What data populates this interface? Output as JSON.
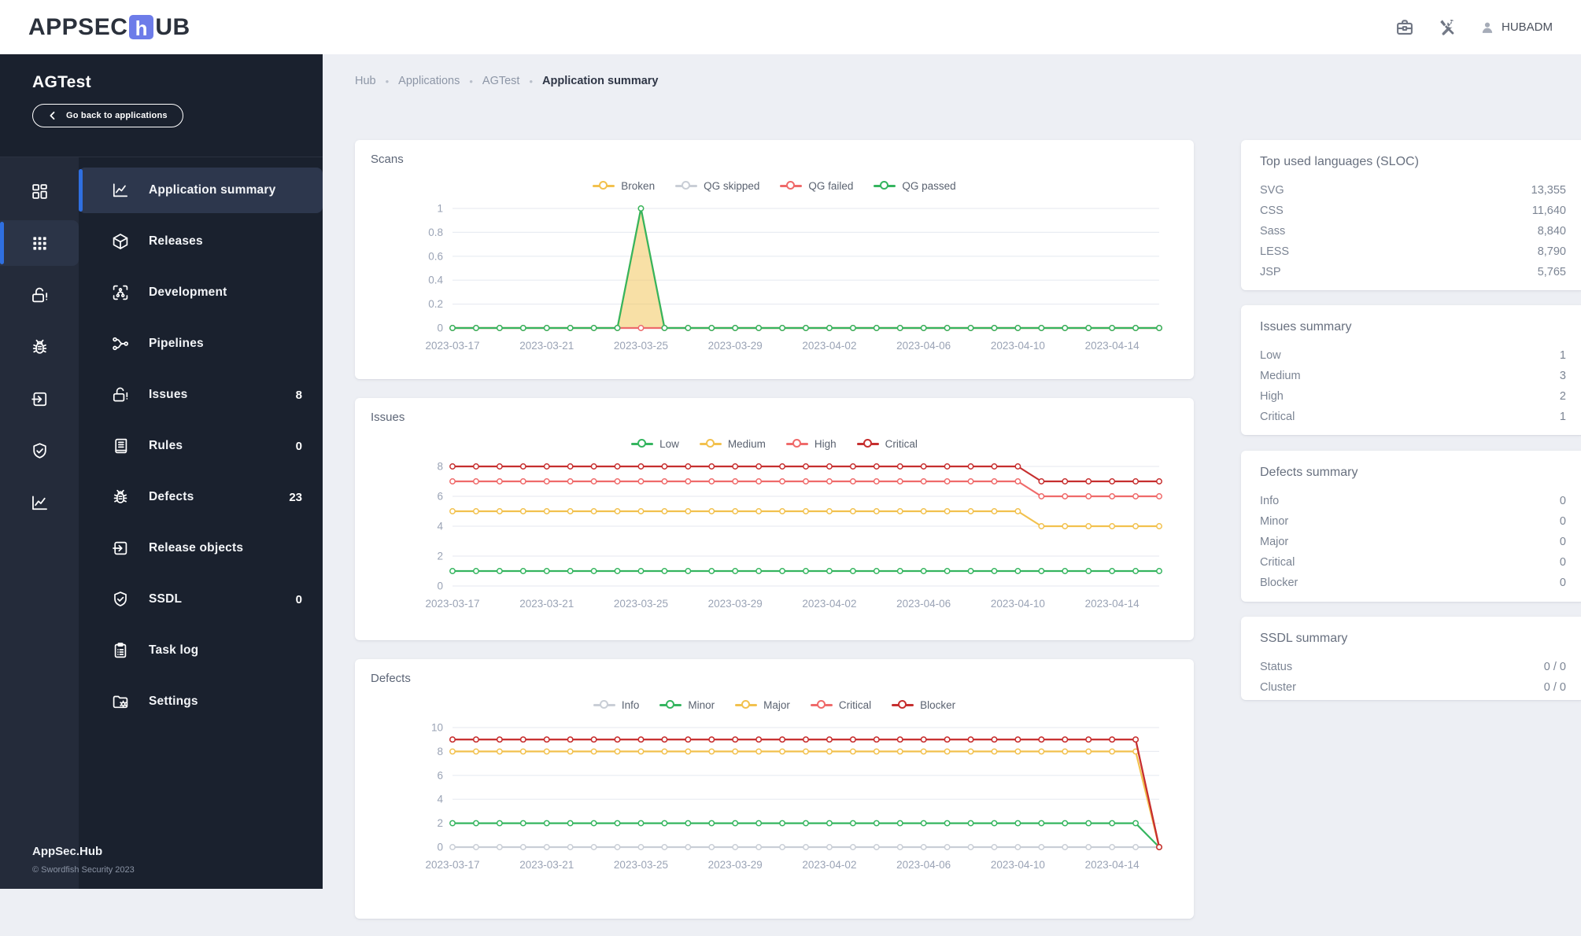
{
  "colors": {
    "accent_blue": "#2f6fe0",
    "logo_blue": "#6d7ce9",
    "sidebar_bg": "#1a212e"
  },
  "header": {
    "logo_prefix": "APPSEC",
    "logo_box_letter": "h",
    "logo_suffix": "UB",
    "icons": [
      "briefcase-icon",
      "tools-icon",
      "user-icon"
    ],
    "user": "HUBADM"
  },
  "sidebar": {
    "app_name": "AGTest",
    "back_button": "Go back to applications",
    "rail": [
      {
        "icon": "dashboard-icon",
        "active": false
      },
      {
        "icon": "grid-icon",
        "active": true
      },
      {
        "icon": "unlock-alert-icon",
        "active": false
      },
      {
        "icon": "bug-icon",
        "active": false
      },
      {
        "icon": "box-arrow-icon",
        "active": false
      },
      {
        "icon": "shield-check-icon",
        "active": false
      },
      {
        "icon": "chart-line-icon",
        "active": false
      }
    ],
    "items": [
      {
        "label": "Application summary",
        "icon": "chart-line-icon",
        "active": true
      },
      {
        "label": "Releases",
        "icon": "package-icon"
      },
      {
        "label": "Development",
        "icon": "development-icon"
      },
      {
        "label": "Pipelines",
        "icon": "pipeline-icon"
      },
      {
        "label": "Issues",
        "icon": "unlock-alert-icon",
        "count": "8"
      },
      {
        "label": "Rules",
        "icon": "rules-icon",
        "count": "0"
      },
      {
        "label": "Defects",
        "icon": "bug-icon",
        "count": "23"
      },
      {
        "label": "Release objects",
        "icon": "box-arrow-icon"
      },
      {
        "label": "SSDL",
        "icon": "shield-check-icon",
        "count": "0"
      },
      {
        "label": "Task log",
        "icon": "clipboard-icon"
      },
      {
        "label": "Settings",
        "icon": "folder-gear-icon"
      }
    ],
    "footer_title": "AppSec.Hub",
    "footer_copyright": "© Swordfish Security 2023"
  },
  "breadcrumb": [
    "Hub",
    "Applications",
    "AGTest",
    "Application summary"
  ],
  "chart_data": [
    {
      "name": "scans",
      "type": "line",
      "title": "Scans",
      "n_points": 31,
      "x_start": "2023-03-17",
      "x_end": "2023-04-16",
      "x_labels": [
        "2023-03-17",
        "2023-03-21",
        "2023-03-25",
        "2023-03-29",
        "2023-04-02",
        "2023-04-06",
        "2023-04-10",
        "2023-04-14"
      ],
      "x_label_indices": [
        0,
        4,
        8,
        12,
        16,
        20,
        24,
        28
      ],
      "y_max": 1,
      "y_ticks": [
        "0",
        "0.2",
        "0.4",
        "0.6",
        "0.8",
        "1"
      ],
      "grid": true,
      "legend_position": "top",
      "series": [
        {
          "name": "Broken",
          "color": "#f2c14e",
          "fill": "rgba(242,193,78,0.5)",
          "values": [
            0,
            0,
            0,
            0,
            0,
            0,
            0,
            0,
            1,
            0,
            0,
            0,
            0,
            0,
            0,
            0,
            0,
            0,
            0,
            0,
            0,
            0,
            0,
            0,
            0,
            0,
            0,
            0,
            0,
            0,
            0
          ]
        },
        {
          "name": "QG skipped",
          "color": "#c9ced6",
          "values": [
            0,
            0,
            0,
            0,
            0,
            0,
            0,
            0,
            0,
            0,
            0,
            0,
            0,
            0,
            0,
            0,
            0,
            0,
            0,
            0,
            0,
            0,
            0,
            0,
            0,
            0,
            0,
            0,
            0,
            0,
            0
          ]
        },
        {
          "name": "QG failed",
          "color": "#ef6a6a",
          "values": [
            0,
            0,
            0,
            0,
            0,
            0,
            0,
            0,
            0,
            0,
            0,
            0,
            0,
            0,
            0,
            0,
            0,
            0,
            0,
            0,
            0,
            0,
            0,
            0,
            0,
            0,
            0,
            0,
            0,
            0,
            0
          ]
        },
        {
          "name": "QG passed",
          "color": "#35b55f",
          "values": [
            0,
            0,
            0,
            0,
            0,
            0,
            0,
            0,
            1,
            0,
            0,
            0,
            0,
            0,
            0,
            0,
            0,
            0,
            0,
            0,
            0,
            0,
            0,
            0,
            0,
            0,
            0,
            0,
            0,
            0,
            0
          ]
        }
      ]
    },
    {
      "name": "issues",
      "type": "line",
      "title": "Issues",
      "n_points": 31,
      "x_start": "2023-03-17",
      "x_end": "2023-04-16",
      "x_labels": [
        "2023-03-17",
        "2023-03-21",
        "2023-03-25",
        "2023-03-29",
        "2023-04-02",
        "2023-04-06",
        "2023-04-10",
        "2023-04-14"
      ],
      "x_label_indices": [
        0,
        4,
        8,
        12,
        16,
        20,
        24,
        28
      ],
      "y_max": 8,
      "y_ticks": [
        "0",
        "2",
        "4",
        "6",
        "8"
      ],
      "grid": true,
      "legend_position": "top",
      "series": [
        {
          "name": "Low",
          "color": "#35b55f",
          "values": [
            1,
            1,
            1,
            1,
            1,
            1,
            1,
            1,
            1,
            1,
            1,
            1,
            1,
            1,
            1,
            1,
            1,
            1,
            1,
            1,
            1,
            1,
            1,
            1,
            1,
            1,
            1,
            1,
            1,
            1,
            1
          ]
        },
        {
          "name": "Medium",
          "color": "#f2c14e",
          "values": [
            5,
            5,
            5,
            5,
            5,
            5,
            5,
            5,
            5,
            5,
            5,
            5,
            5,
            5,
            5,
            5,
            5,
            5,
            5,
            5,
            5,
            5,
            5,
            5,
            5,
            4,
            4,
            4,
            4,
            4,
            4
          ]
        },
        {
          "name": "High",
          "color": "#ef6a6a",
          "values": [
            7,
            7,
            7,
            7,
            7,
            7,
            7,
            7,
            7,
            7,
            7,
            7,
            7,
            7,
            7,
            7,
            7,
            7,
            7,
            7,
            7,
            7,
            7,
            7,
            7,
            6,
            6,
            6,
            6,
            6,
            6
          ]
        },
        {
          "name": "Critical",
          "color": "#c62f2f",
          "values": [
            8,
            8,
            8,
            8,
            8,
            8,
            8,
            8,
            8,
            8,
            8,
            8,
            8,
            8,
            8,
            8,
            8,
            8,
            8,
            8,
            8,
            8,
            8,
            8,
            8,
            7,
            7,
            7,
            7,
            7,
            7
          ]
        }
      ]
    },
    {
      "name": "defects",
      "type": "line",
      "title": "Defects",
      "n_points": 31,
      "x_start": "2023-03-17",
      "x_end": "2023-04-16",
      "x_labels": [
        "2023-03-17",
        "2023-03-21",
        "2023-03-25",
        "2023-03-29",
        "2023-04-02",
        "2023-04-06",
        "2023-04-10",
        "2023-04-14"
      ],
      "x_label_indices": [
        0,
        4,
        8,
        12,
        16,
        20,
        24,
        28
      ],
      "y_max": 10,
      "y_ticks": [
        "0",
        "2",
        "4",
        "6",
        "8",
        "10"
      ],
      "grid": true,
      "legend_position": "top",
      "series": [
        {
          "name": "Info",
          "color": "#c9ced6",
          "values": [
            0,
            0,
            0,
            0,
            0,
            0,
            0,
            0,
            0,
            0,
            0,
            0,
            0,
            0,
            0,
            0,
            0,
            0,
            0,
            0,
            0,
            0,
            0,
            0,
            0,
            0,
            0,
            0,
            0,
            0,
            0
          ]
        },
        {
          "name": "Minor",
          "color": "#35b55f",
          "values": [
            2,
            2,
            2,
            2,
            2,
            2,
            2,
            2,
            2,
            2,
            2,
            2,
            2,
            2,
            2,
            2,
            2,
            2,
            2,
            2,
            2,
            2,
            2,
            2,
            2,
            2,
            2,
            2,
            2,
            2,
            0
          ]
        },
        {
          "name": "Major",
          "color": "#f2c14e",
          "values": [
            8,
            8,
            8,
            8,
            8,
            8,
            8,
            8,
            8,
            8,
            8,
            8,
            8,
            8,
            8,
            8,
            8,
            8,
            8,
            8,
            8,
            8,
            8,
            8,
            8,
            8,
            8,
            8,
            8,
            8,
            0
          ]
        },
        {
          "name": "Critical",
          "color": "#ef6a6a",
          "values": [
            9,
            9,
            9,
            9,
            9,
            9,
            9,
            9,
            9,
            9,
            9,
            9,
            9,
            9,
            9,
            9,
            9,
            9,
            9,
            9,
            9,
            9,
            9,
            9,
            9,
            9,
            9,
            9,
            9,
            9,
            0
          ]
        },
        {
          "name": "Blocker",
          "color": "#c62f2f",
          "values": [
            9,
            9,
            9,
            9,
            9,
            9,
            9,
            9,
            9,
            9,
            9,
            9,
            9,
            9,
            9,
            9,
            9,
            9,
            9,
            9,
            9,
            9,
            9,
            9,
            9,
            9,
            9,
            9,
            9,
            9,
            0
          ]
        }
      ]
    }
  ],
  "panels": [
    {
      "title": "Top used languages (SLOC)",
      "rows": [
        {
          "label": "SVG",
          "value": "13,355"
        },
        {
          "label": "CSS",
          "value": "11,640"
        },
        {
          "label": "Sass",
          "value": "8,840"
        },
        {
          "label": "LESS",
          "value": "8,790"
        },
        {
          "label": "JSP",
          "value": "5,765"
        }
      ]
    },
    {
      "title": "Issues summary",
      "rows": [
        {
          "label": "Low",
          "value": "1"
        },
        {
          "label": "Medium",
          "value": "3"
        },
        {
          "label": "High",
          "value": "2"
        },
        {
          "label": "Critical",
          "value": "1"
        }
      ]
    },
    {
      "title": "Defects summary",
      "rows": [
        {
          "label": "Info",
          "value": "0"
        },
        {
          "label": "Minor",
          "value": "0"
        },
        {
          "label": "Major",
          "value": "0"
        },
        {
          "label": "Critical",
          "value": "0"
        },
        {
          "label": "Blocker",
          "value": "0"
        }
      ]
    },
    {
      "title": "SSDL summary",
      "rows": [
        {
          "label": "Status",
          "value": "0 / 0"
        },
        {
          "label": "Cluster",
          "value": "0 / 0"
        }
      ]
    }
  ]
}
